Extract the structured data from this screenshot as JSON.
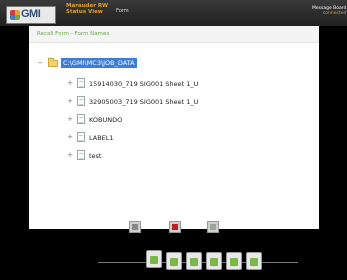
{
  "header": {
    "logo_text": "GMI",
    "app_title_line1": "Marauder RW",
    "app_title_line2": "Status View",
    "form_label": "Form",
    "message_line1": "Message Board",
    "message_line2": "connected"
  },
  "panel": {
    "title": "Recall Form - Form Names",
    "tree": [
      {
        "label": "C:\\GMI\\MC3\\JOB_DATA",
        "type": "folder",
        "expanded": true,
        "selected": true
      },
      {
        "label": "15914030_719 SIG001 Sheet 1_U",
        "type": "document"
      },
      {
        "label": "32905003_719 SIG001 Sheet 1_U",
        "type": "document"
      },
      {
        "label": "KOBUNDO",
        "type": "document"
      },
      {
        "label": "LABEL1",
        "type": "document"
      },
      {
        "label": "test",
        "type": "document"
      }
    ]
  },
  "footer_buttons": [
    {
      "name": "back",
      "icon": "arrow-left-icon"
    },
    {
      "name": "stop",
      "icon": "stop-icon",
      "color": "#b22222"
    },
    {
      "name": "forward",
      "icon": "arrow-right-icon"
    }
  ],
  "dock": {
    "items": [
      "dock-app-1",
      "dock-app-2",
      "dock-app-3",
      "dock-app-4",
      "dock-app-5",
      "dock-app-6"
    ]
  },
  "colors": {
    "accent": "#6aa84f",
    "selection": "#3b7dd8",
    "title_orange": "#e0a020"
  }
}
